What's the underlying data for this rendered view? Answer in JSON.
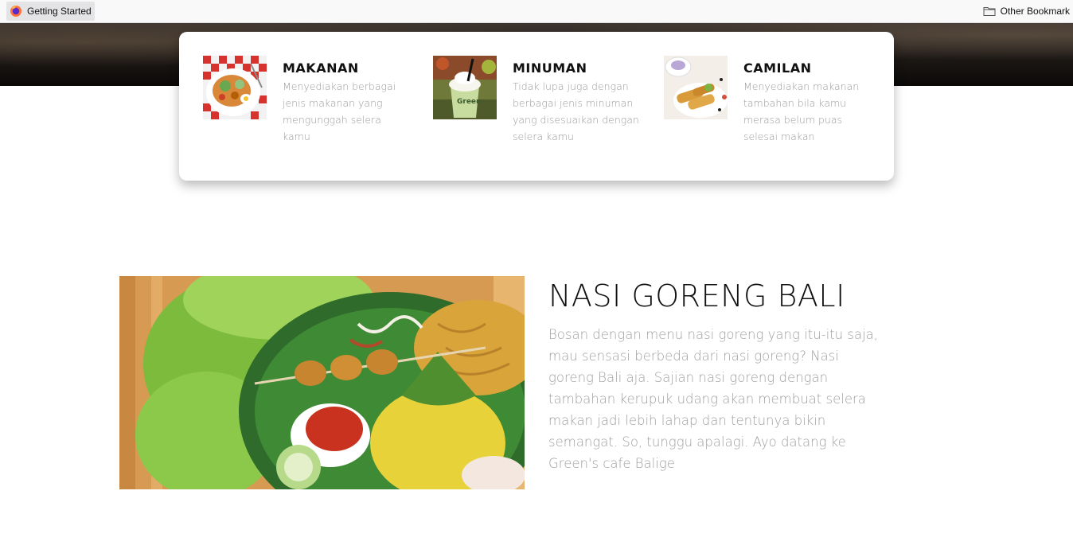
{
  "bookmarks": {
    "getting_started": "Getting Started",
    "other": "Other Bookmark"
  },
  "features": [
    {
      "title": "MAKANAN",
      "description": "Menyediakan berbagai jenis makanan yang mengunggah selera kamu",
      "image": "food-plate-photo"
    },
    {
      "title": "MINUMAN",
      "description": "Tidak lupa juga dengan berbagai jenis minuman yang disesuaikan dengan selera kamu",
      "image": "green-drink-photo"
    },
    {
      "title": "CAMILAN",
      "description": "Menyediakan makanan tambahan bila kamu merasa belum puas selesai makan",
      "image": "spring-rolls-photo"
    }
  ],
  "dish": {
    "title": "NASI GORENG BALI",
    "description": "Bosan dengan menu nasi goreng yang itu-itu saja, mau sensasi berbeda dari nasi goreng? Nasi goreng Bali aja. Sajian nasi goreng dengan tambahan kerupuk udang akan membuat selera makan jadi lebih lahap dan tentunya bikin semangat. So, tunggu apalagi. Ayo datang ke Green's cafe Balige",
    "image": "nasi-goreng-photo"
  },
  "colors": {
    "card_bg": "#ffffff",
    "title_text": "#111111",
    "muted_text": "#9a9a9a"
  }
}
